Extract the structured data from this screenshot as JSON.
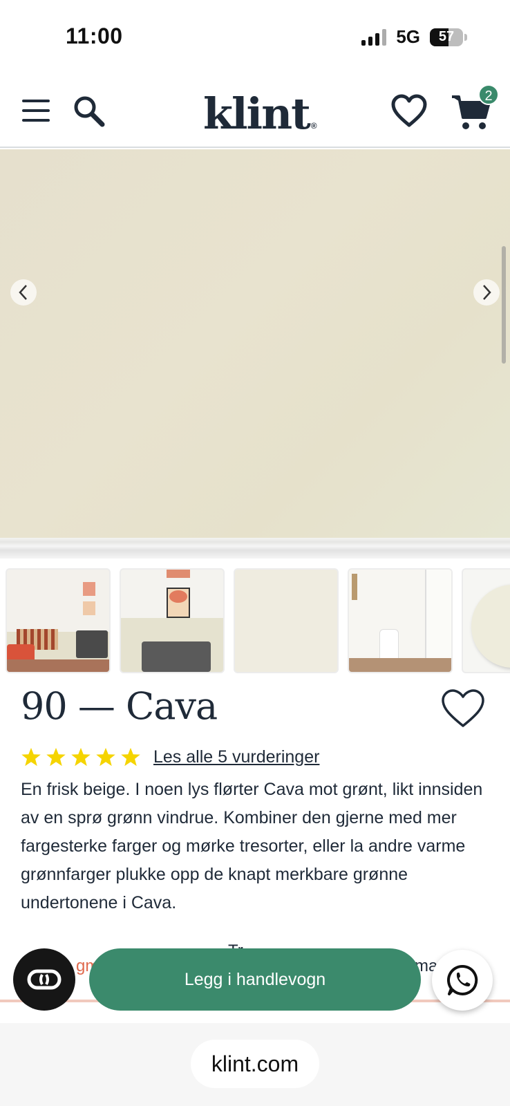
{
  "status_bar": {
    "time": "11:00",
    "network": "5G",
    "battery": "57"
  },
  "header": {
    "logo": "klint",
    "logo_mark": "®",
    "cart_count": "2",
    "icons": [
      "menu-icon",
      "search-icon",
      "heart-icon",
      "cart-icon"
    ]
  },
  "gallery": {
    "main_color": "#e7e2cd",
    "thumbnails": [
      "room-scene",
      "art-scene",
      "color-swatch",
      "hallway-scene",
      "paint-blob"
    ]
  },
  "product": {
    "title": "90 — Cava",
    "rating": 5,
    "reviews_link": "Les alle 5 vurderinger",
    "description": "En frisk beige. I noen lys flørter Cava mot grønt, likt innsiden av en sprø grønn vindrue. Kombiner den gjerne med mer fargesterke farger og mørke tresorter, eller la andre varme grønnfarger plukke opp de knapt merkbare grønne undertonene i Cava."
  },
  "tabs_peek": {
    "left": "gm",
    "middle": "Tr ",
    "right": "ma"
  },
  "actions": {
    "add_to_cart": "Legg i handlevogn"
  },
  "browser": {
    "url": "klint.com"
  },
  "colors": {
    "brand_dark": "#1f2a38",
    "accent_green": "#3b8a6c",
    "star_yellow": "#f5d400",
    "accent_orange": "#e06a4e"
  }
}
